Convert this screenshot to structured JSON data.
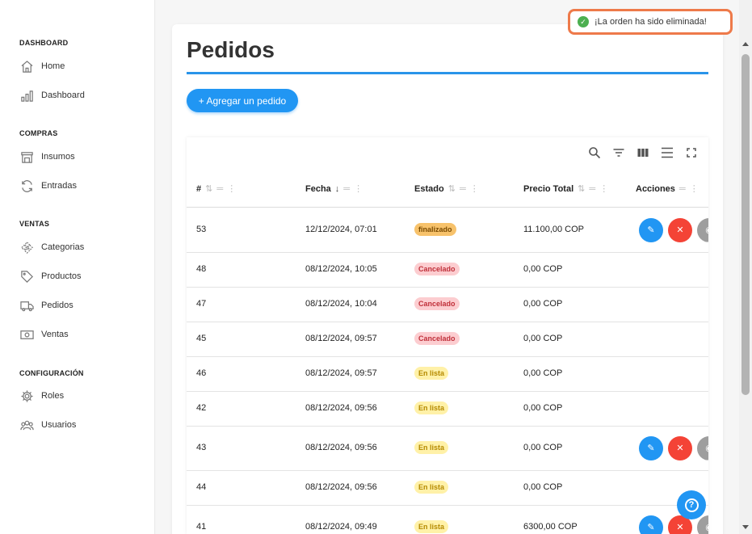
{
  "sidebar": {
    "sections": [
      {
        "title": "DASHBOARD",
        "items": [
          {
            "label": "Home",
            "icon": "home-icon"
          },
          {
            "label": "Dashboard",
            "icon": "bar-chart-icon"
          }
        ]
      },
      {
        "title": "COMPRAS",
        "items": [
          {
            "label": "Insumos",
            "icon": "store-icon"
          },
          {
            "label": "Entradas",
            "icon": "refresh-icon"
          }
        ]
      },
      {
        "title": "VENTAS",
        "items": [
          {
            "label": "Categorias",
            "icon": "categories-icon"
          },
          {
            "label": "Productos",
            "icon": "tag-icon"
          },
          {
            "label": "Pedidos",
            "icon": "truck-icon"
          },
          {
            "label": "Ventas",
            "icon": "cash-icon"
          }
        ]
      },
      {
        "title": "CONFIGURACIÓN",
        "items": [
          {
            "label": "Roles",
            "icon": "gear-icon"
          },
          {
            "label": "Usuarios",
            "icon": "users-icon"
          }
        ]
      }
    ]
  },
  "page": {
    "title": "Pedidos",
    "add_button": "+ Agregar un pedido"
  },
  "toast": {
    "message": "¡La orden ha sido eliminada!",
    "icon": "check-circle-icon"
  },
  "table": {
    "toolbar_icons": [
      "search-icon",
      "filter-icon",
      "columns-icon",
      "density-icon",
      "fullscreen-icon"
    ],
    "columns": [
      "#",
      "Fecha",
      "Estado",
      "Precio Total",
      "Acciones"
    ],
    "rows": [
      {
        "id": "53",
        "fecha": "12/12/2024, 07:01",
        "estado": "finalizado",
        "precio": "11.100,00 COP",
        "actions": true
      },
      {
        "id": "48",
        "fecha": "08/12/2024, 10:05",
        "estado": "Cancelado",
        "precio": "0,00 COP",
        "actions": false
      },
      {
        "id": "47",
        "fecha": "08/12/2024, 10:04",
        "estado": "Cancelado",
        "precio": "0,00 COP",
        "actions": false
      },
      {
        "id": "45",
        "fecha": "08/12/2024, 09:57",
        "estado": "Cancelado",
        "precio": "0,00 COP",
        "actions": false
      },
      {
        "id": "46",
        "fecha": "08/12/2024, 09:57",
        "estado": "En lista",
        "precio": "0,00 COP",
        "actions": false
      },
      {
        "id": "42",
        "fecha": "08/12/2024, 09:56",
        "estado": "En lista",
        "precio": "0,00 COP",
        "actions": false
      },
      {
        "id": "43",
        "fecha": "08/12/2024, 09:56",
        "estado": "En lista",
        "precio": "0,00 COP",
        "actions": true
      },
      {
        "id": "44",
        "fecha": "08/12/2024, 09:56",
        "estado": "En lista",
        "precio": "0,00 COP",
        "actions": false
      },
      {
        "id": "41",
        "fecha": "08/12/2024, 09:49",
        "estado": "En lista",
        "precio": "6300,00 COP",
        "actions": true
      }
    ]
  },
  "colors": {
    "primary": "#2196f3",
    "danger": "#f44336",
    "toast_border": "#ee7a4a",
    "status_finalizado": "#f7c26b",
    "status_cancelado": "#fccdd0",
    "status_enlista": "#fff1a8"
  }
}
